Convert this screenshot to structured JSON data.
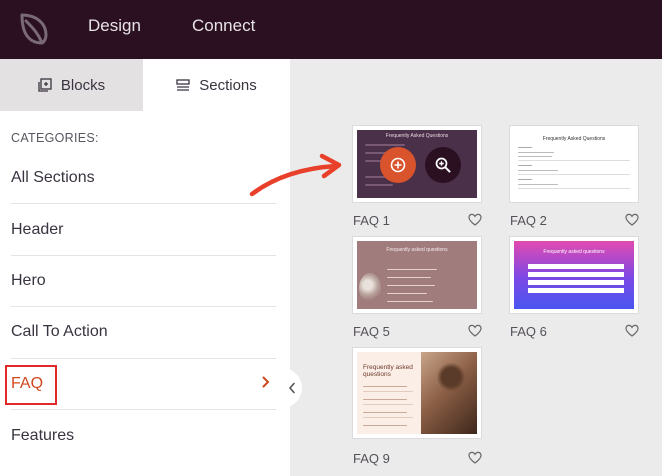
{
  "topbar": {
    "nav": [
      {
        "label": "Design"
      },
      {
        "label": "Connect"
      }
    ]
  },
  "sidebar": {
    "tabs": [
      {
        "label": "Blocks",
        "icon": "blocks-icon"
      },
      {
        "label": "Sections",
        "icon": "sections-icon"
      }
    ],
    "categories_heading": "CATEGORIES:",
    "categories": [
      {
        "label": "All Sections"
      },
      {
        "label": "Header"
      },
      {
        "label": "Hero"
      },
      {
        "label": "Call To Action"
      },
      {
        "label": "FAQ",
        "active": true
      },
      {
        "label": "Features"
      }
    ]
  },
  "sections": [
    {
      "label": "FAQ 1",
      "thumb_title": "Frequently Asked Questions"
    },
    {
      "label": "FAQ 2",
      "thumb_title": "Frequently Asked Questions"
    },
    {
      "label": "FAQ 5",
      "thumb_title": "Frequently asked questions"
    },
    {
      "label": "FAQ 6",
      "thumb_title": "Frequently asked questions"
    },
    {
      "label": "FAQ 9",
      "thumb_title": "Frequently asked questions"
    }
  ],
  "colors": {
    "topbar": "#2a1020",
    "accent": "#d1481f",
    "highlight_box": "#e02a2a",
    "arrow": "#e8402a"
  }
}
